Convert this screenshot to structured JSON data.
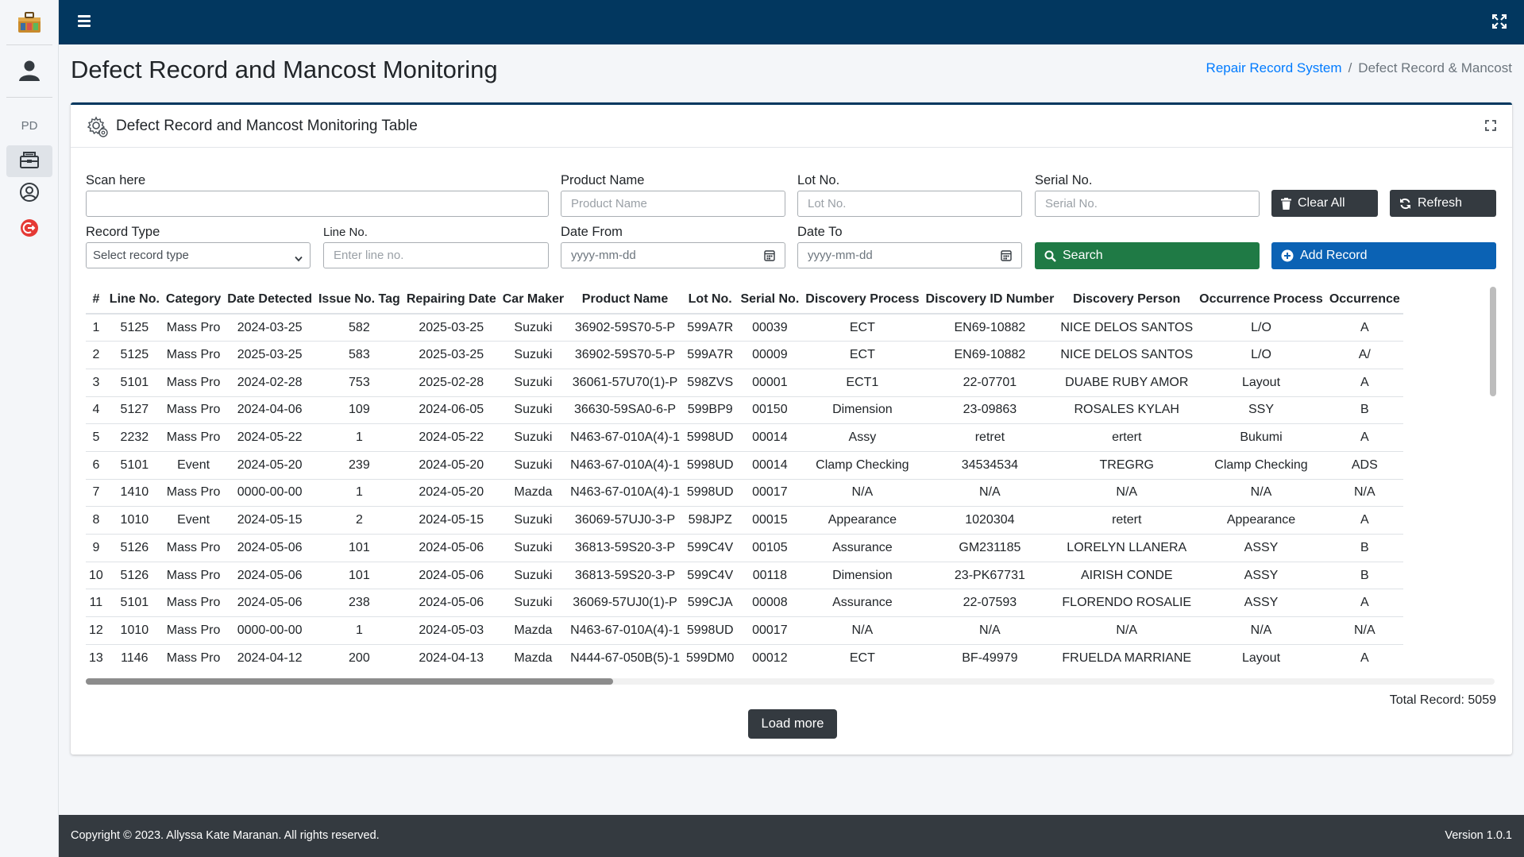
{
  "sidebar": {
    "logo_icon": "toolbox-logo-icon",
    "avatar_icon": "user-avatar-icon",
    "section_label": "PD",
    "items": [
      {
        "icon": "file-cabinet-icon",
        "active": true
      },
      {
        "icon": "user-circle-icon",
        "active": false
      },
      {
        "icon": "logout-icon",
        "active": false
      }
    ]
  },
  "topbar": {
    "menu_icon": "hamburger-icon",
    "fullscreen_icon": "expand-icon"
  },
  "page": {
    "title": "Defect Record and Mancost Monitoring",
    "breadcrumb": {
      "link": "Repair Record System",
      "separator": "/",
      "current": "Defect Record & Mancost"
    }
  },
  "card": {
    "title": "Defect Record and Mancost Monitoring Table",
    "title_icon": "gear-cog-icon",
    "expand_icon": "maximize-icon"
  },
  "filters": {
    "scan": {
      "label": "Scan here",
      "value": "",
      "placeholder": ""
    },
    "product_name": {
      "label": "Product Name",
      "placeholder": "Product Name"
    },
    "lot_no": {
      "label": "Lot No.",
      "placeholder": "Lot No."
    },
    "serial_no": {
      "label": "Serial No.",
      "placeholder": "Serial No."
    },
    "record_type": {
      "label": "Record Type",
      "selected": "Select record type"
    },
    "line_no": {
      "label": "Line No.",
      "placeholder": "Enter line no."
    },
    "date_from": {
      "label": "Date From",
      "placeholder": "yyyy-mm-dd"
    },
    "date_to": {
      "label": "Date To",
      "placeholder": "yyyy-mm-dd"
    }
  },
  "buttons": {
    "clear_all": "Clear All",
    "refresh": "Refresh",
    "search": "Search",
    "add_record": "Add Record",
    "load_more": "Load more"
  },
  "colors": {
    "navbar": "#02375f",
    "search": "#1f7a45",
    "add": "#0b62b4",
    "dark": "#343a40",
    "link": "#007bff"
  },
  "table": {
    "columns": [
      "#",
      "Line No.",
      "Category",
      "Date Detected",
      "Issue No. Tag",
      "Repairing Date",
      "Car Maker",
      "Product Name",
      "Lot No.",
      "Serial No.",
      "Discovery Process",
      "Discovery ID Number",
      "Discovery Person",
      "Occurrence Process",
      "Occurrence"
    ],
    "rows": [
      [
        "1",
        "5125",
        "Mass Pro",
        "2024-03-25",
        "582",
        "2025-03-25",
        "Suzuki",
        "36902-59S70-5-P",
        "599A7R",
        "00039",
        "ECT",
        "EN69-10882",
        "NICE DELOS SANTOS",
        "L/O",
        "A"
      ],
      [
        "2",
        "5125",
        "Mass Pro",
        "2025-03-25",
        "583",
        "2025-03-25",
        "Suzuki",
        "36902-59S70-5-P",
        "599A7R",
        "00009",
        "ECT",
        "EN69-10882",
        "NICE DELOS SANTOS",
        "L/O",
        "A/"
      ],
      [
        "3",
        "5101",
        "Mass Pro",
        "2024-02-28",
        "753",
        "2025-02-28",
        "Suzuki",
        "36061-57U70(1)-P",
        "598ZVS",
        "00001",
        "ECT1",
        "22-07701",
        "DUABE RUBY AMOR",
        "Layout",
        "A"
      ],
      [
        "4",
        "5127",
        "Mass Pro",
        "2024-04-06",
        "109",
        "2024-06-05",
        "Suzuki",
        "36630-59SA0-6-P",
        "599BP9",
        "00150",
        "Dimension",
        "23-09863",
        "ROSALES KYLAH",
        "SSY",
        "B"
      ],
      [
        "5",
        "2232",
        "Mass Pro",
        "2024-05-22",
        "1",
        "2024-05-22",
        "Suzuki",
        "N463-67-010A(4)-1",
        "5998UD",
        "00014",
        "Assy",
        "retret",
        "ertert",
        "Bukumi",
        "A"
      ],
      [
        "6",
        "5101",
        "Event",
        "2024-05-20",
        "239",
        "2024-05-20",
        "Suzuki",
        "N463-67-010A(4)-1",
        "5998UD",
        "00014",
        "Clamp Checking",
        "34534534",
        "TREGRG",
        "Clamp Checking",
        "ADS"
      ],
      [
        "7",
        "1410",
        "Mass Pro",
        "0000-00-00",
        "1",
        "2024-05-20",
        "Mazda",
        "N463-67-010A(4)-1",
        "5998UD",
        "00017",
        "N/A",
        "N/A",
        "N/A",
        "N/A",
        "N/A"
      ],
      [
        "8",
        "1010",
        "Event",
        "2024-05-15",
        "2",
        "2024-05-15",
        "Suzuki",
        "36069-57UJ0-3-P",
        "598JPZ",
        "00015",
        "Appearance",
        "1020304",
        "retert",
        "Appearance",
        "A"
      ],
      [
        "9",
        "5126",
        "Mass Pro",
        "2024-05-06",
        "101",
        "2024-05-06",
        "Suzuki",
        "36813-59S20-3-P",
        "599C4V",
        "00105",
        "Assurance",
        "GM231185",
        "LORELYN LLANERA",
        "ASSY",
        "B"
      ],
      [
        "10",
        "5126",
        "Mass Pro",
        "2024-05-06",
        "101",
        "2024-05-06",
        "Suzuki",
        "36813-59S20-3-P",
        "599C4V",
        "00118",
        "Dimension",
        "23-PK67731",
        "AIRISH CONDE",
        "ASSY",
        "B"
      ],
      [
        "11",
        "5101",
        "Mass Pro",
        "2024-05-06",
        "238",
        "2024-05-06",
        "Suzuki",
        "36069-57UJ0(1)-P",
        "599CJA",
        "00008",
        "Assurance",
        "22-07593",
        "FLORENDO ROSALIE",
        "ASSY",
        "A"
      ],
      [
        "12",
        "1010",
        "Mass Pro",
        "0000-00-00",
        "1",
        "2024-05-03",
        "Mazda",
        "N463-67-010A(4)-1",
        "5998UD",
        "00017",
        "N/A",
        "N/A",
        "N/A",
        "N/A",
        "N/A"
      ],
      [
        "13",
        "1146",
        "Mass Pro",
        "2024-04-12",
        "200",
        "2024-04-13",
        "Mazda",
        "N444-67-050B(5)-1",
        "599DM0",
        "00012",
        "ECT",
        "BF-49979",
        "FRUELDA MARRIANE",
        "Layout",
        "A"
      ]
    ],
    "total_record": "Total Record: 5059"
  },
  "footer": {
    "copyright": "Copyright © 2023. Allyssa Kate Maranan. All rights reserved.",
    "version": "Version 1.0.1"
  }
}
